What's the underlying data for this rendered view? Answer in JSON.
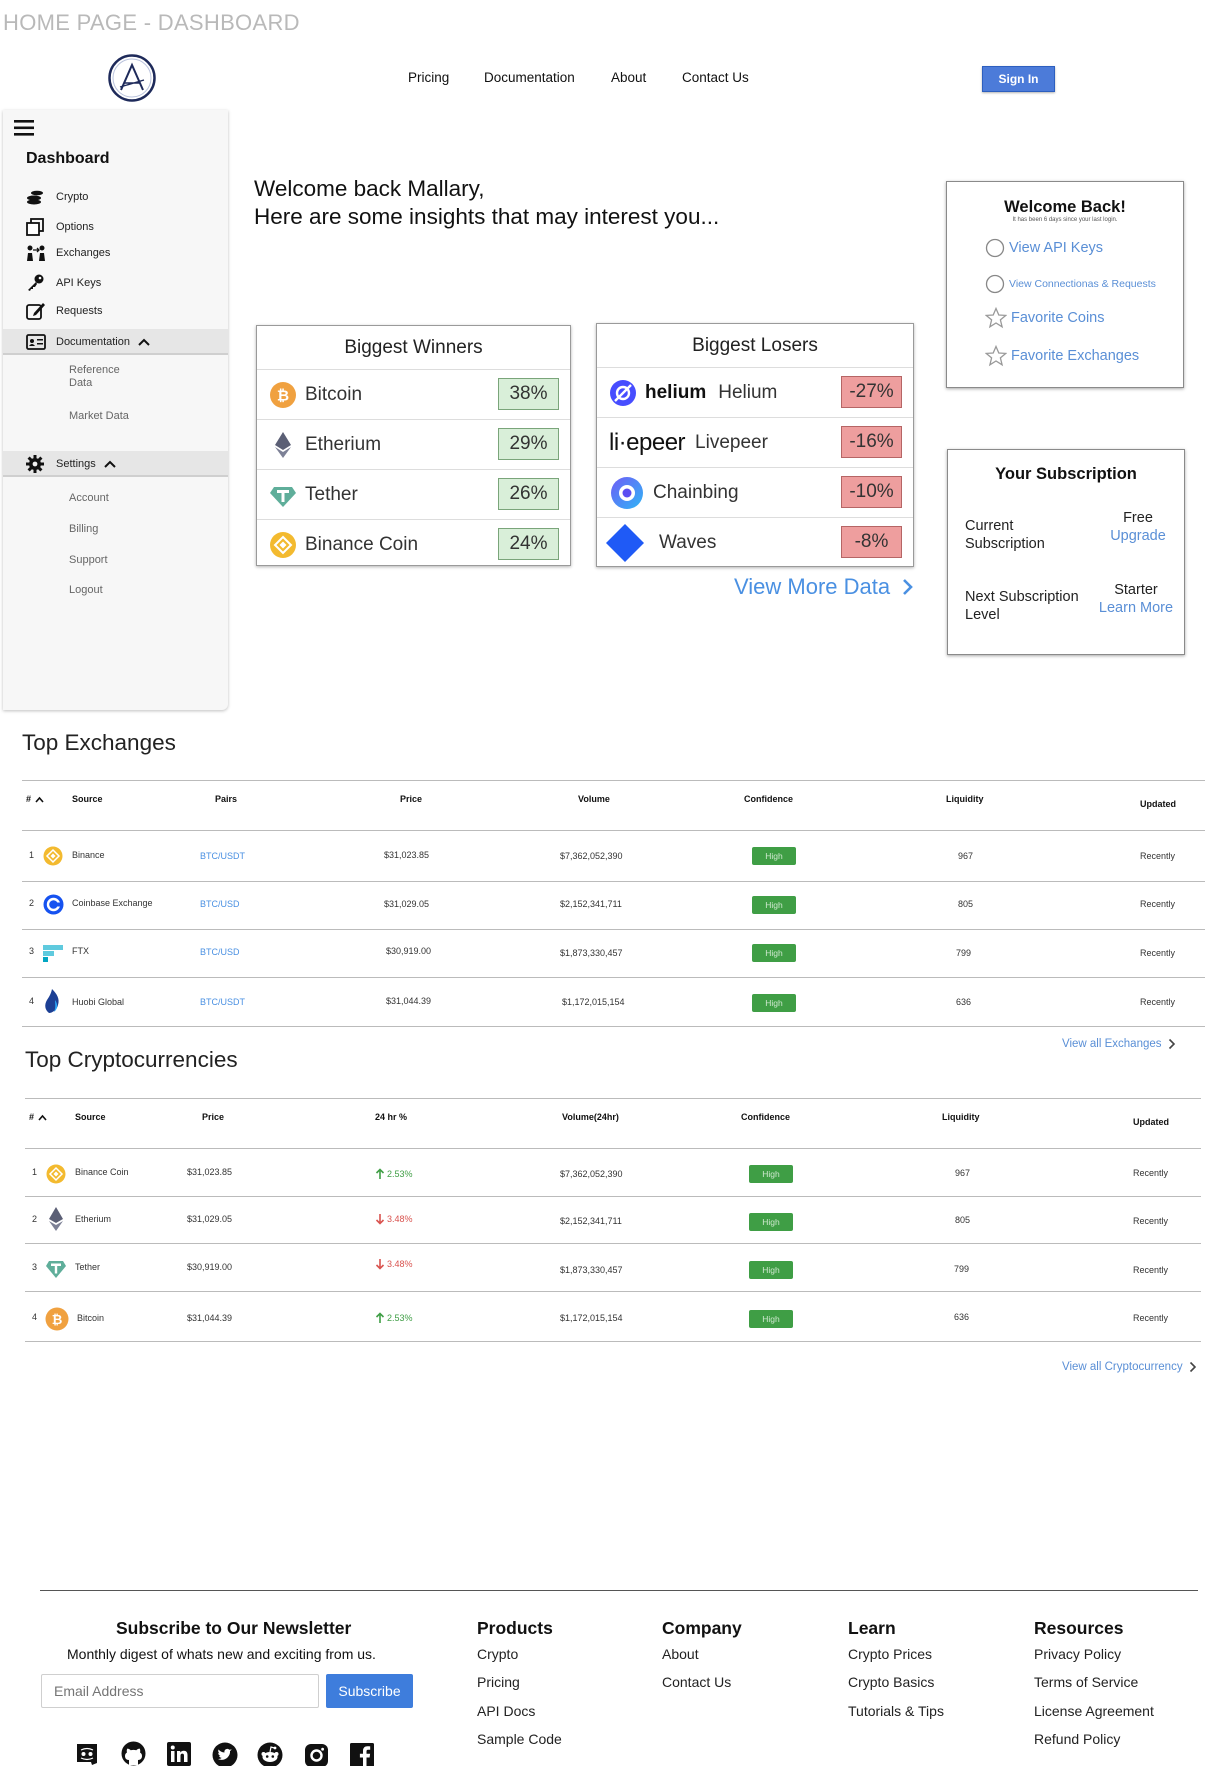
{
  "page_label": "HOME PAGE - DASHBOARD",
  "nav": {
    "pricing": "Pricing",
    "documentation": "Documentation",
    "about": "About",
    "contact": "Contact Us",
    "sign_in": "Sign In"
  },
  "sidebar": {
    "title": "Dashboard",
    "items": [
      "Crypto",
      "Options",
      "Exchanges",
      "API Keys",
      "Requests",
      "Documentation"
    ],
    "doc_sub": [
      "Reference",
      "Data",
      "Market Data"
    ],
    "settings": "Settings",
    "settings_sub": [
      "Account",
      "Billing",
      "Support",
      "Logout"
    ]
  },
  "welcome": {
    "line1": "Welcome back Mallary,",
    "line2": "Here are some insights that may interest you..."
  },
  "winners": {
    "title": "Biggest Winners",
    "rows": [
      {
        "name": "Bitcoin",
        "pct": "38%"
      },
      {
        "name": "Etherium",
        "pct": "29%"
      },
      {
        "name": "Tether",
        "pct": "26%"
      },
      {
        "name": "Binance Coin",
        "pct": "24%"
      }
    ]
  },
  "losers": {
    "title": "Biggest Losers",
    "rows": [
      {
        "brand": "helium",
        "name": "Helium",
        "pct": "-27%"
      },
      {
        "brand": "li·epeer",
        "name": "Livepeer",
        "pct": "-16%"
      },
      {
        "name": "Chainbing",
        "pct": "-10%"
      },
      {
        "name": "Waves",
        "pct": "-8%"
      }
    ]
  },
  "view_more": "View More Data",
  "welcome_card": {
    "title": "Welcome Back!",
    "subtitle": "It has been 6 days since your last login.",
    "links": [
      "View API Keys",
      "View Connectionas & Requests",
      "Favorite Coins",
      "Favorite Exchanges"
    ]
  },
  "subscription": {
    "title": "Your Subscription",
    "current_label": "Current Subscription",
    "current_value": "Free",
    "upgrade": "Upgrade",
    "next_label": "Next Subscription Level",
    "next_value": "Starter",
    "learn_more": "Learn More"
  },
  "exchanges": {
    "title": "Top Exchanges",
    "headers": [
      "#",
      "Source",
      "Pairs",
      "Price",
      "Volume",
      "Confidence",
      "Liquidity",
      "Updated"
    ],
    "rows": [
      {
        "n": "1",
        "source": "Binance",
        "pair": "BTC/USDT",
        "price": "$31,023.85",
        "volume": "$7,362,052,390",
        "conf": "High",
        "liq": "967",
        "upd": "Recently"
      },
      {
        "n": "2",
        "source": "Coinbase Exchange",
        "pair": "BTC/USD",
        "price": "$31,029.05",
        "volume": "$2,152,341,711",
        "conf": "High",
        "liq": "805",
        "upd": "Recently"
      },
      {
        "n": "3",
        "source": "FTX",
        "pair": "BTC/USD",
        "price": "$30,919.00",
        "volume": "$1,873,330,457",
        "conf": "High",
        "liq": "799",
        "upd": "Recently"
      },
      {
        "n": "4",
        "source": "Huobi Global",
        "pair": "BTC/USDT",
        "price": "$31,044.39",
        "volume": "$1,172,015,154",
        "conf": "High",
        "liq": "636",
        "upd": "Recently"
      }
    ],
    "view_all": "View all Exchanges"
  },
  "cryptos": {
    "title": "Top Cryptocurrencies",
    "headers": [
      "#",
      "Source",
      "Price",
      "24 hr %",
      "Volume(24hr)",
      "Confidence",
      "Liquidity",
      "Updated"
    ],
    "rows": [
      {
        "n": "1",
        "source": "Binance Coin",
        "price": "$31,023.85",
        "chg": "2.53%",
        "dir": "up",
        "volume": "$7,362,052,390",
        "conf": "High",
        "liq": "967",
        "upd": "Recently"
      },
      {
        "n": "2",
        "source": "Etherium",
        "price": "$31,029.05",
        "chg": "3.48%",
        "dir": "down",
        "volume": "$2,152,341,711",
        "conf": "High",
        "liq": "805",
        "upd": "Recently"
      },
      {
        "n": "3",
        "source": "Tether",
        "price": "$30,919.00",
        "chg": "3.48%",
        "dir": "down",
        "volume": "$1,873,330,457",
        "conf": "High",
        "liq": "799",
        "upd": "Recently"
      },
      {
        "n": "4",
        "source": "Bitcoin",
        "price": "$31,044.39",
        "chg": "2.53%",
        "dir": "up",
        "volume": "$1,172,015,154",
        "conf": "High",
        "liq": "636",
        "upd": "Recently"
      }
    ],
    "view_all": "View all Cryptocurrency"
  },
  "footer": {
    "newsletter_title": "Subscribe to Our Newsletter",
    "newsletter_desc": "Monthly digest of whats new and exciting from us.",
    "email_placeholder": "Email Address",
    "subscribe": "Subscribe",
    "cols": [
      {
        "title": "Products",
        "links": [
          "Crypto",
          "Pricing",
          "API Docs",
          "Sample Code"
        ]
      },
      {
        "title": "Company",
        "links": [
          "About",
          "Contact Us"
        ]
      },
      {
        "title": "Learn",
        "links": [
          "Crypto Prices",
          "Crypto Basics",
          "Tutorials & Tips"
        ]
      },
      {
        "title": "Resources",
        "links": [
          "Privacy Policy",
          "Terms of Service",
          "License Agreement",
          "Refund Policy"
        ]
      }
    ]
  },
  "colors": {
    "accent": "#4c7bd9",
    "link": "#4a90e2",
    "positive": "#d9efd9",
    "negative": "#ee9e9e",
    "badge": "#3f9e45"
  }
}
